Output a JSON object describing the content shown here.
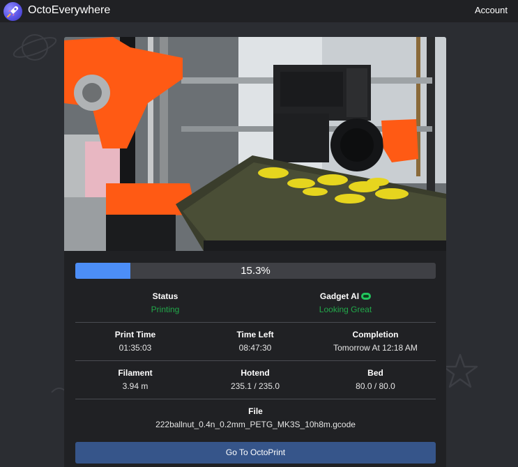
{
  "header": {
    "brand": "OctoEverywhere",
    "account_label": "Account"
  },
  "icons": {
    "logo": "rocket-logo-icon",
    "gadget_badge": "gadget-ai-icon"
  },
  "colors": {
    "accent_blue": "#4c8ef7",
    "status_green": "#22a84a",
    "button_blue": "#36558a"
  },
  "webcam": {
    "description_hidden": true
  },
  "progress": {
    "percent": 15.3,
    "label": "15.3%"
  },
  "status": {
    "status_label": "Status",
    "status_value": "Printing",
    "gadget_label": "Gadget AI",
    "gadget_value": "Looking Great"
  },
  "times": {
    "print_time_label": "Print Time",
    "print_time_value": "01:35:03",
    "time_left_label": "Time Left",
    "time_left_value": "08:47:30",
    "completion_label": "Completion",
    "completion_value": "Tomorrow At 12:18 AM"
  },
  "temps": {
    "filament_label": "Filament",
    "filament_value": "3.94 m",
    "hotend_label": "Hotend",
    "hotend_value": "235.1 / 235.0",
    "bed_label": "Bed",
    "bed_value": "80.0 / 80.0"
  },
  "file": {
    "label": "File",
    "name": "222ballnut_0.4n_0.2mm_PETG_MK3S_10h8m.gcode"
  },
  "actions": {
    "open_label": "Go To OctoPrint"
  }
}
